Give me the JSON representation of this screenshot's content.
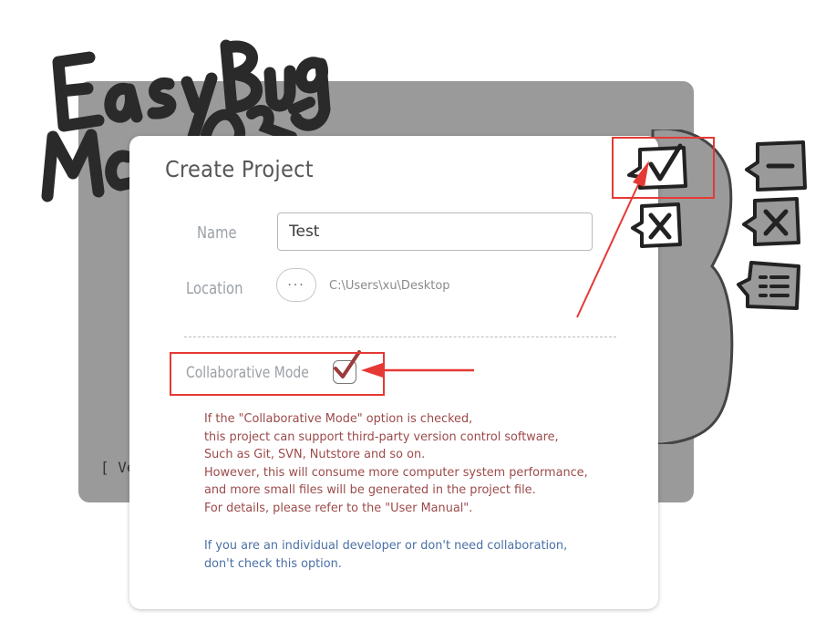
{
  "app": {
    "logo_text": "EasyBug Manager",
    "version_text": "[ Ve"
  },
  "dialog": {
    "title": "Create Project",
    "name_label": "Name",
    "name_value": "Test",
    "location_label": "Location",
    "browse_label": "···",
    "location_path": "C:\\Users\\xu\\Desktop",
    "collab_label": "Collaborative Mode",
    "collab_checked": true,
    "description_lines": [
      "If the \"Collaborative Mode\" option is checked,",
      "this project can support third-party version control software,",
      "Such as Git, SVN, Nutstore and so on.",
      "However, this will consume more computer system performance,",
      "and more small files will be generated in the project file.",
      "For details, please refer to the \"User Manual\"."
    ],
    "note_lines": [
      "If you are an individual developer or don't need collaboration,",
      "don't check this option."
    ]
  },
  "side_icons": [
    "confirm-check-icon",
    "cancel-x-icon",
    "minus-bubble-icon",
    "close-bubble-icon",
    "list-bubble-icon"
  ],
  "colors": {
    "annotation": "#e53935",
    "description_text": "#9c4a4a",
    "note_text": "#4a6fa5",
    "panel_bg": "#9a9a9a"
  }
}
